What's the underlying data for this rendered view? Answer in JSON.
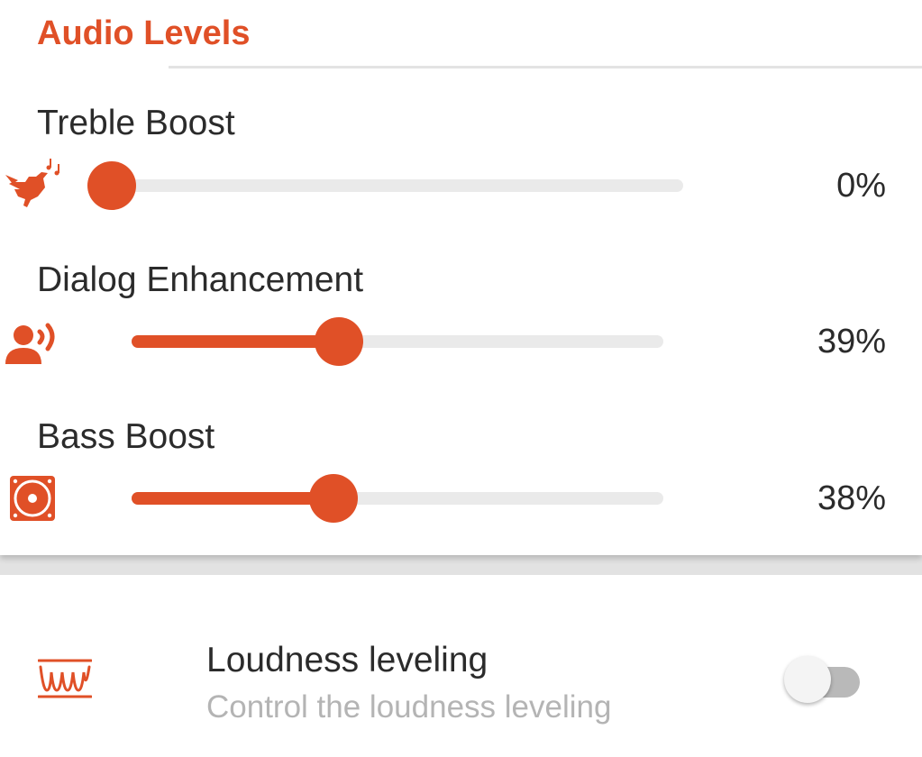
{
  "section_title": "Audio Levels",
  "sliders": [
    {
      "label": "Treble Boost",
      "value": 0,
      "value_text": "0%",
      "icon": "bird-icon"
    },
    {
      "label": "Dialog Enhancement",
      "value": 39,
      "value_text": "39%",
      "icon": "speaking-person-icon"
    },
    {
      "label": "Bass Boost",
      "value": 38,
      "value_text": "38%",
      "icon": "subwoofer-icon"
    }
  ],
  "loudness": {
    "title": "Loudness leveling",
    "subtitle": "Control the loudness leveling",
    "enabled": false,
    "icon": "waveform-icon"
  },
  "colors": {
    "accent": "#e05027",
    "track": "#eaeaea",
    "toggle_off": "#b9b9b9"
  }
}
